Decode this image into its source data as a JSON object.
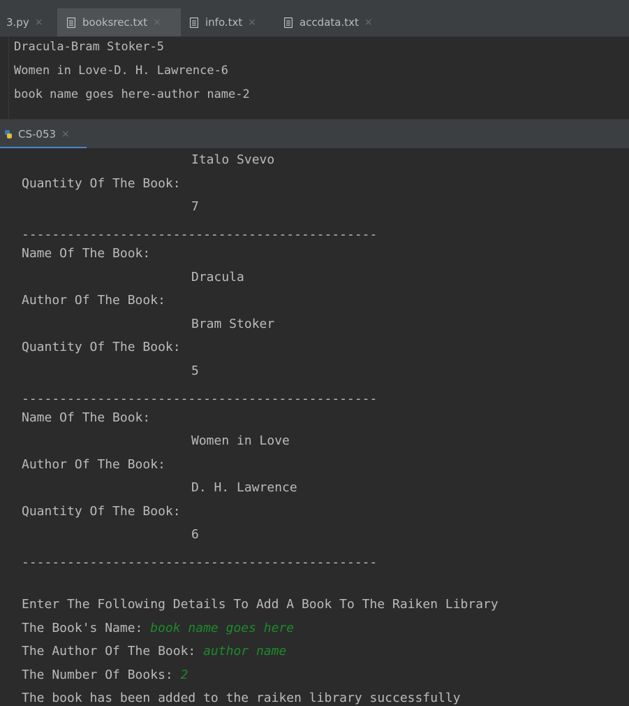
{
  "editor_tabs": [
    {
      "label": "3.py",
      "active": false,
      "icon": "python-file-icon"
    },
    {
      "label": "booksrec.txt",
      "active": true,
      "icon": "text-file-icon"
    },
    {
      "label": "info.txt",
      "active": false,
      "icon": "text-file-icon"
    },
    {
      "label": "accdata.txt",
      "active": false,
      "icon": "text-file-icon"
    }
  ],
  "close_glyph": "×",
  "editor_lines": [
    "Dracula-Bram Stoker-5",
    "Women in Love-D. H. Lawrence-6",
    "book name goes here-author name-2"
  ],
  "run_tab": {
    "label": "CS-053",
    "icon": "python-run-icon"
  },
  "console": {
    "separator": "-----------------------------------------------",
    "labels": {
      "name": "Name Of The Book:",
      "author": "Author Of The Book:",
      "quantity": "Quantity Of The Book:"
    },
    "partial_record": {
      "author": "Italo Svevo",
      "quantity": "7"
    },
    "records": [
      {
        "name": "Dracula",
        "author": "Bram Stoker",
        "quantity": "5"
      },
      {
        "name": "Women in Love",
        "author": "D. H. Lawrence",
        "quantity": "6"
      }
    ],
    "prompt_header": "Enter The Following Details To Add A Book To The Raiken Library",
    "prompts": {
      "book_name": "The Book's Name: ",
      "author": "The Author Of The Book: ",
      "number": "The Number Of Books: "
    },
    "inputs": {
      "book_name": "book name goes here",
      "author": "author name",
      "number": "2"
    },
    "success": "The book has been added to the raiken library successfully"
  },
  "colors": {
    "background": "#2b2b2b",
    "text": "#bbbbbb",
    "user_input": "#1d8a2a",
    "tab_bar": "#3c3f41",
    "active_tab": "#4e5254",
    "run_tab_accent": "#4a88c7"
  }
}
